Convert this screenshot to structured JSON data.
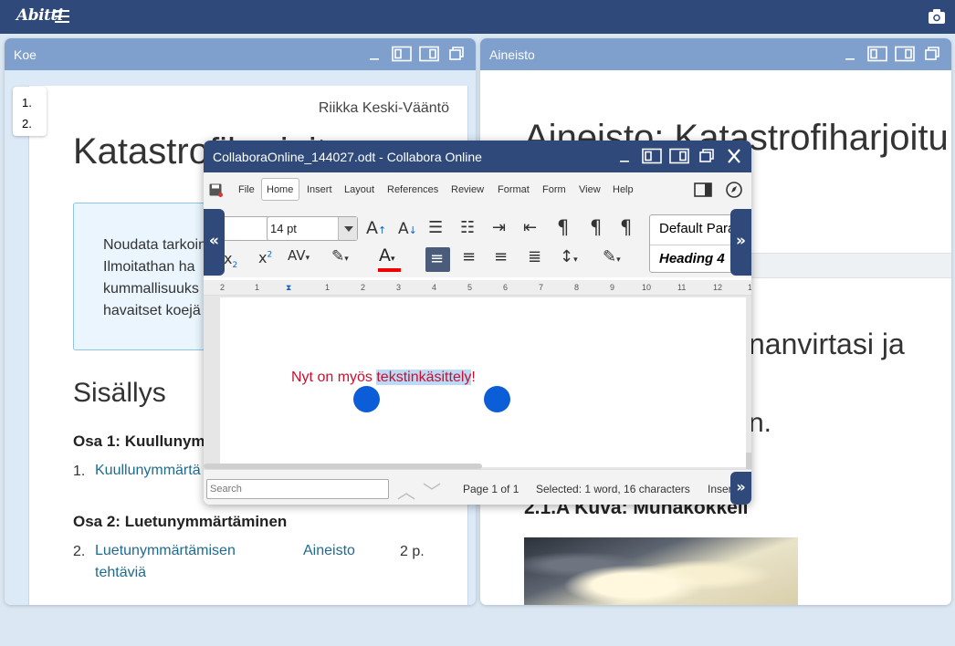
{
  "app": {
    "logo": "Abitti"
  },
  "koe": {
    "title": "Koe",
    "toc": [
      "1.",
      "2."
    ],
    "author": "Riikka Keski-Vääntö",
    "exam_title": "Katastrofiharjoitus",
    "instructions": [
      "Noudata tarkoin",
      "Ilmoitathan ha",
      "kummallisuuks",
      "havaitset koejä"
    ],
    "contents_heading": "Sisällys",
    "part1_heading": "Osa 1: Kuullunym",
    "part1_num": "1.",
    "part1_link": "Kuullunymmärtä",
    "part2_heading": "Osa 2: Luetunymmärtäminen",
    "part2_num": "2.",
    "part2_link_line1": "Luetunymmärtämisen",
    "part2_link_line2": "tehtäviä",
    "part2_material": "Aineisto",
    "part2_points": "2 p."
  },
  "aineisto": {
    "title": "Aineisto",
    "page_title": "Aineisto: Katastrofiharjoitu",
    "heading_partial": "nanvirtasi ja",
    "heading_partial2": "n.",
    "subheading": "2.1.A Kuva: Munakokkeli"
  },
  "collabora": {
    "title": "CollaboraOnline_144027.odt - Collabora Online",
    "menu": [
      "File",
      "Home",
      "Insert",
      "Layout",
      "References",
      "Review",
      "Format",
      "Form",
      "View",
      "Help"
    ],
    "font_size": "14 pt",
    "styles": [
      "Default Para",
      "Heading 4"
    ],
    "ruler": [
      "2",
      "1",
      "1",
      "1",
      "2",
      "3",
      "4",
      "5",
      "6",
      "7",
      "8",
      "9",
      "10",
      "11",
      "12",
      "1"
    ],
    "doc_text_before": "Nyt on myös ",
    "doc_text_selected": "tekstinkäsittely",
    "doc_text_after": "!",
    "search_placeholder": "Search",
    "page_info": "Page 1 of 1",
    "selection_info": "Selected: 1 word, 16 characters",
    "insert_mode": "Inser",
    "text_color": "#c8102e"
  }
}
